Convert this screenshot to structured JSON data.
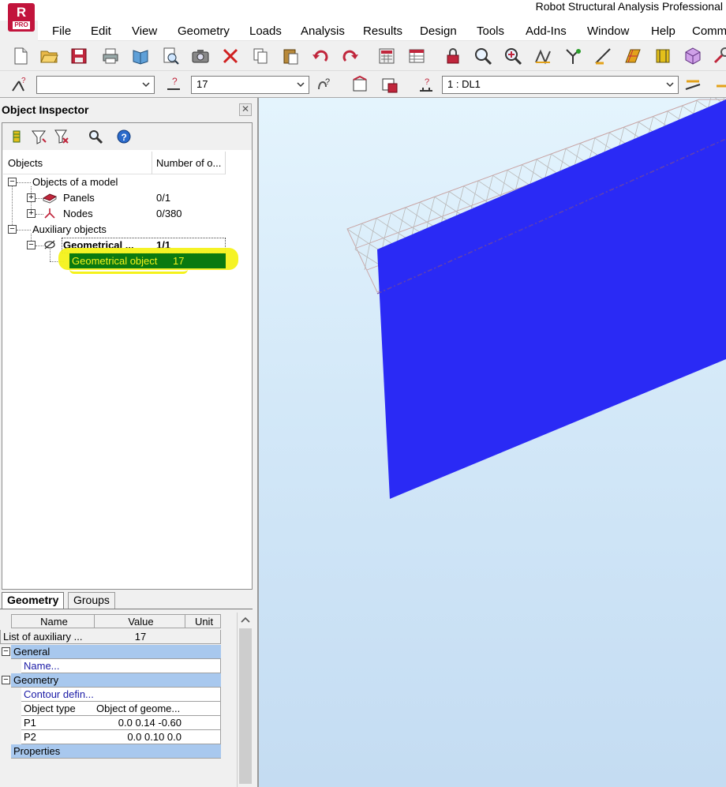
{
  "app": {
    "title": "Robot Structural Analysis Professional",
    "logo_letter": "R",
    "logo_badge": "PRO",
    "accent": "#c2143c"
  },
  "menu": {
    "items": [
      "File",
      "Edit",
      "View",
      "Geometry",
      "Loads",
      "Analysis",
      "Results",
      "Design",
      "Tools",
      "Add-Ins",
      "Window",
      "Help",
      "Comm"
    ]
  },
  "toolbar2": {
    "selection_combo_value": "",
    "object_combo_value": "17",
    "load_case_combo_value": "1 : DL1"
  },
  "inspector": {
    "title": "Object Inspector",
    "close_glyph": "✕",
    "columns": [
      "Objects",
      "Number of o..."
    ],
    "tree": {
      "objects_of_model": "Objects of a model",
      "panels_label": "Panels",
      "panels_count": "0/1",
      "nodes_label": "Nodes",
      "nodes_count": "0/380",
      "auxiliary_objects": "Auxiliary objects",
      "geometrical_group_label": "Geometrical ...",
      "geometrical_group_count": "1/1",
      "geometrical_object_label": "Geometrical object",
      "geometrical_object_id": "17"
    },
    "tabs": [
      "Geometry",
      "Groups"
    ]
  },
  "property_grid": {
    "headers": [
      "Name",
      "Value",
      "Unit"
    ],
    "list_row": {
      "name": "List of auxiliary ...",
      "value": "17"
    },
    "section_general": "General",
    "name_row": "Name...",
    "section_geometry": "Geometry",
    "contour_row": "Contour defin...",
    "object_type": {
      "name": "Object type",
      "value": "Object of geome..."
    },
    "p1": {
      "name": "P1",
      "value": "0.0 0.14 -0.60"
    },
    "p2": {
      "name": "P2",
      "value": "0.0 0.10 0.0"
    },
    "properties_row": "Properties"
  },
  "colors": {
    "panel_blue": "#2a2af5",
    "selection_green": "#0a7a10",
    "highlight_yellow": "#f4f21a",
    "section_blue": "#a8c8ee"
  }
}
